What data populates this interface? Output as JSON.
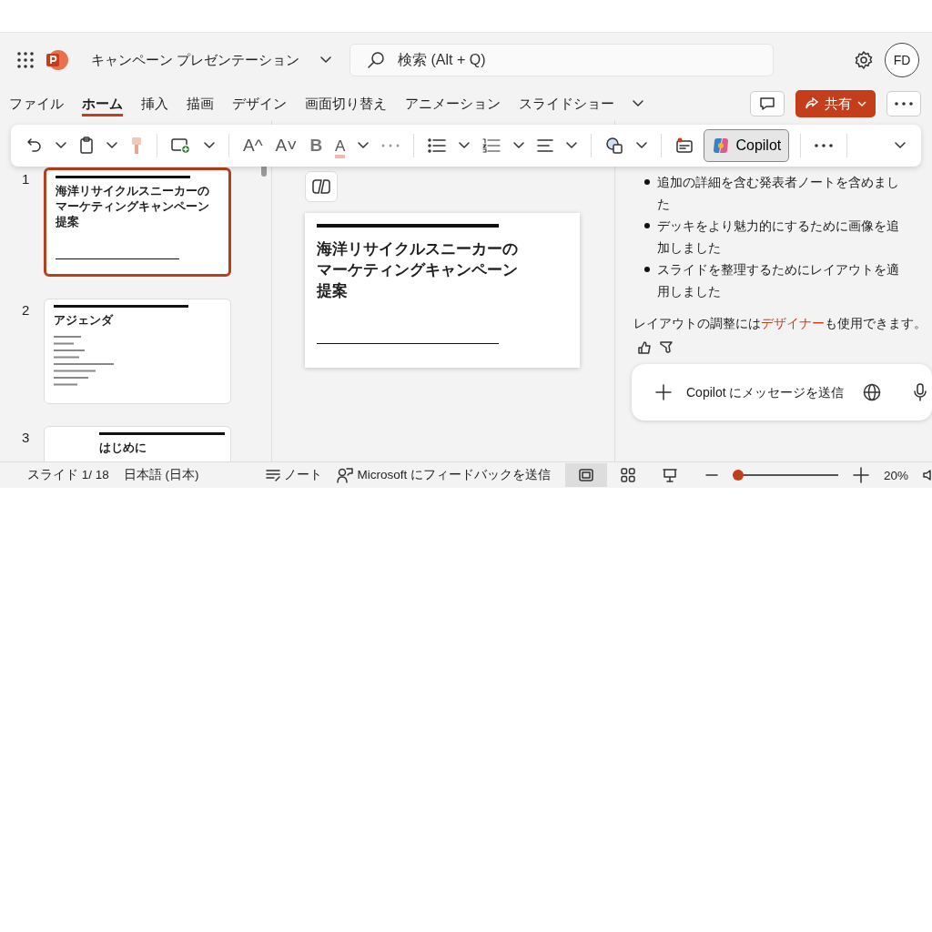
{
  "titlebar": {
    "document_title": "キャンペーン プレゼンテーション",
    "search": {
      "placeholder": "検索 (Alt + Q)"
    },
    "avatar": "FD"
  },
  "ribbon_tabs": [
    {
      "label": "ファイル",
      "selected": false
    },
    {
      "label": "ホーム",
      "selected": true
    },
    {
      "label": "挿入",
      "selected": false
    },
    {
      "label": "描画",
      "selected": false
    },
    {
      "label": "デザイン",
      "selected": false
    },
    {
      "label": "画面切り替え",
      "selected": false
    },
    {
      "label": "アニメーション",
      "selected": false
    },
    {
      "label": "スライドショー",
      "selected": false
    }
  ],
  "share_button": "共有",
  "toolbar": {
    "grow_font": "A^",
    "shrink_font": "A˅",
    "bold": "B",
    "font_color": "A",
    "copilot": {
      "label": "Copilot",
      "selected": true
    }
  },
  "slides": [
    {
      "number": "1",
      "kind": "title",
      "selected": true,
      "title": "海洋リサイクルスニーカーのマーケティングキャンペーン提案"
    },
    {
      "number": "2",
      "kind": "agenda",
      "selected": false,
      "title": "アジェンダ"
    },
    {
      "number": "3",
      "kind": "section",
      "selected": false,
      "title": "はじめに"
    }
  ],
  "current_slide": {
    "title": "海洋リサイクルスニーカーのマーケティングキャンペーン提案"
  },
  "copilot_panel": {
    "bullets": [
      "追加の詳細を含む発表者ノートを含めました",
      "デッキをより魅力的にするために画像を追加しました",
      "スライドを整理するためにレイアウトを適用しました"
    ],
    "message": "レイアウトの調整には**デザイナー**も使用できます。",
    "input": {
      "placeholder": "Copilot にメッセージを送信"
    }
  },
  "status_bar": {
    "slide_counter": "スライド 1/ 18",
    "language": "日本語 (日本)",
    "notes": "ノート",
    "feedback": "Microsoft にフィードバックを送信",
    "views": [
      {
        "selected": true
      },
      {
        "selected": false
      },
      {
        "selected": false
      }
    ],
    "zoom": {
      "level": 0.0,
      "reading": "20%"
    }
  }
}
